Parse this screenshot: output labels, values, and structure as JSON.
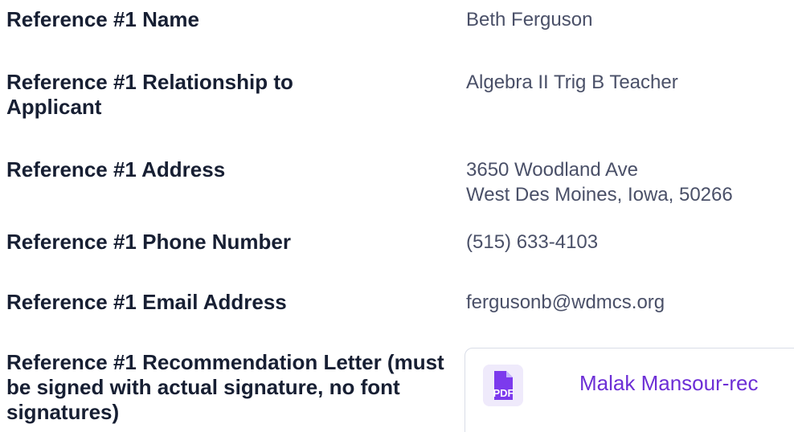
{
  "fields": [
    {
      "label": "Reference #1 Name",
      "value": "Beth Ferguson"
    },
    {
      "label": "Reference #1 Relationship to Applicant",
      "value": "Algebra II Trig B Teacher"
    },
    {
      "label": "Reference #1 Address",
      "value_lines": [
        "3650 Woodland Ave",
        "West Des Moines, Iowa, 50266"
      ]
    },
    {
      "label": "Reference #1 Phone Number",
      "value": "(515) 633-4103"
    },
    {
      "label": "Reference #1 Email Address",
      "value": "fergusonb@wdmcs.org"
    },
    {
      "label": "Reference #1 Recommendation Letter (must be signed with actual signature, no font signatures)"
    }
  ],
  "attachment": {
    "icon": "pdf-file-icon",
    "icon_text": "PDF",
    "file_name": "Malak Mansour-rec",
    "accent_color": "#7c3aed"
  }
}
